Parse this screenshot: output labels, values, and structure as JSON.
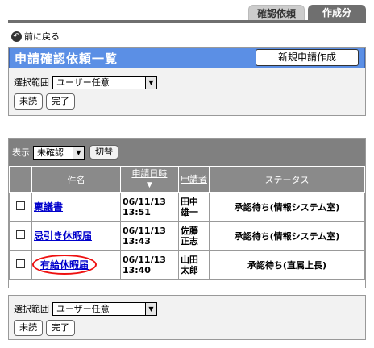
{
  "tabs": {
    "confirm": "確認依頼",
    "create": "作成分"
  },
  "back_label": "前に戻る",
  "panel_title": "申請確認依頼一覧",
  "new_button": "新規申請作成",
  "range_label": "選択範囲",
  "range_value": "ユーザー任意",
  "unread_button": "未読",
  "done_button": "完了",
  "display": {
    "label": "表示",
    "value": "未確認",
    "switch_button": "切替"
  },
  "table": {
    "headers": {
      "name": "件名",
      "date": "申請日時",
      "applicant": "申請者",
      "status": "ステータス"
    },
    "rows": [
      {
        "name": "稟議書",
        "date": "06/11/13",
        "time": "13:51",
        "applicant": "田中",
        "applicant2": "雄一",
        "status": "承認待ち(情報システム室)"
      },
      {
        "name": "忌引き休暇届",
        "date": "06/11/13",
        "time": "13:43",
        "applicant": "佐藤",
        "applicant2": "正志",
        "status": "承認待ち(情報システム室)"
      },
      {
        "name": "有給休暇届",
        "date": "06/11/13",
        "time": "13:40",
        "applicant": "山田",
        "applicant2": "太郎",
        "status": "承認待ち(直属上長)"
      }
    ]
  },
  "bottom": {
    "range_label": "選択範囲",
    "range_value": "ユーザー任意",
    "unread_button": "未読",
    "done_button": "完了"
  }
}
